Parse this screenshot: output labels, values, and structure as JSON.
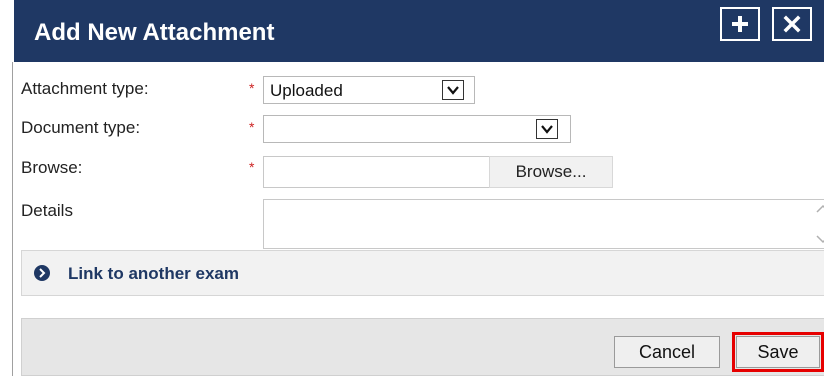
{
  "dialog": {
    "title": "Add New Attachment",
    "header_buttons": {
      "add_icon": "plus-icon",
      "close_icon": "close-icon"
    }
  },
  "form": {
    "attachment_type": {
      "label": "Attachment type:",
      "value": "Uploaded",
      "required_mark": "*"
    },
    "document_type": {
      "label": "Document type:",
      "value": "",
      "required_mark": "*"
    },
    "browse": {
      "label": "Browse:",
      "value": "",
      "button_label": "Browse...",
      "required_mark": "*"
    },
    "details": {
      "label": "Details",
      "value": ""
    }
  },
  "link": {
    "label": "Link to another exam",
    "icon": "chevron-right-circle-icon"
  },
  "footer": {
    "cancel_label": "Cancel",
    "save_label": "Save"
  },
  "colors": {
    "header_bg": "#1f3864",
    "required": "#cc2222",
    "highlight": "#e60000"
  }
}
